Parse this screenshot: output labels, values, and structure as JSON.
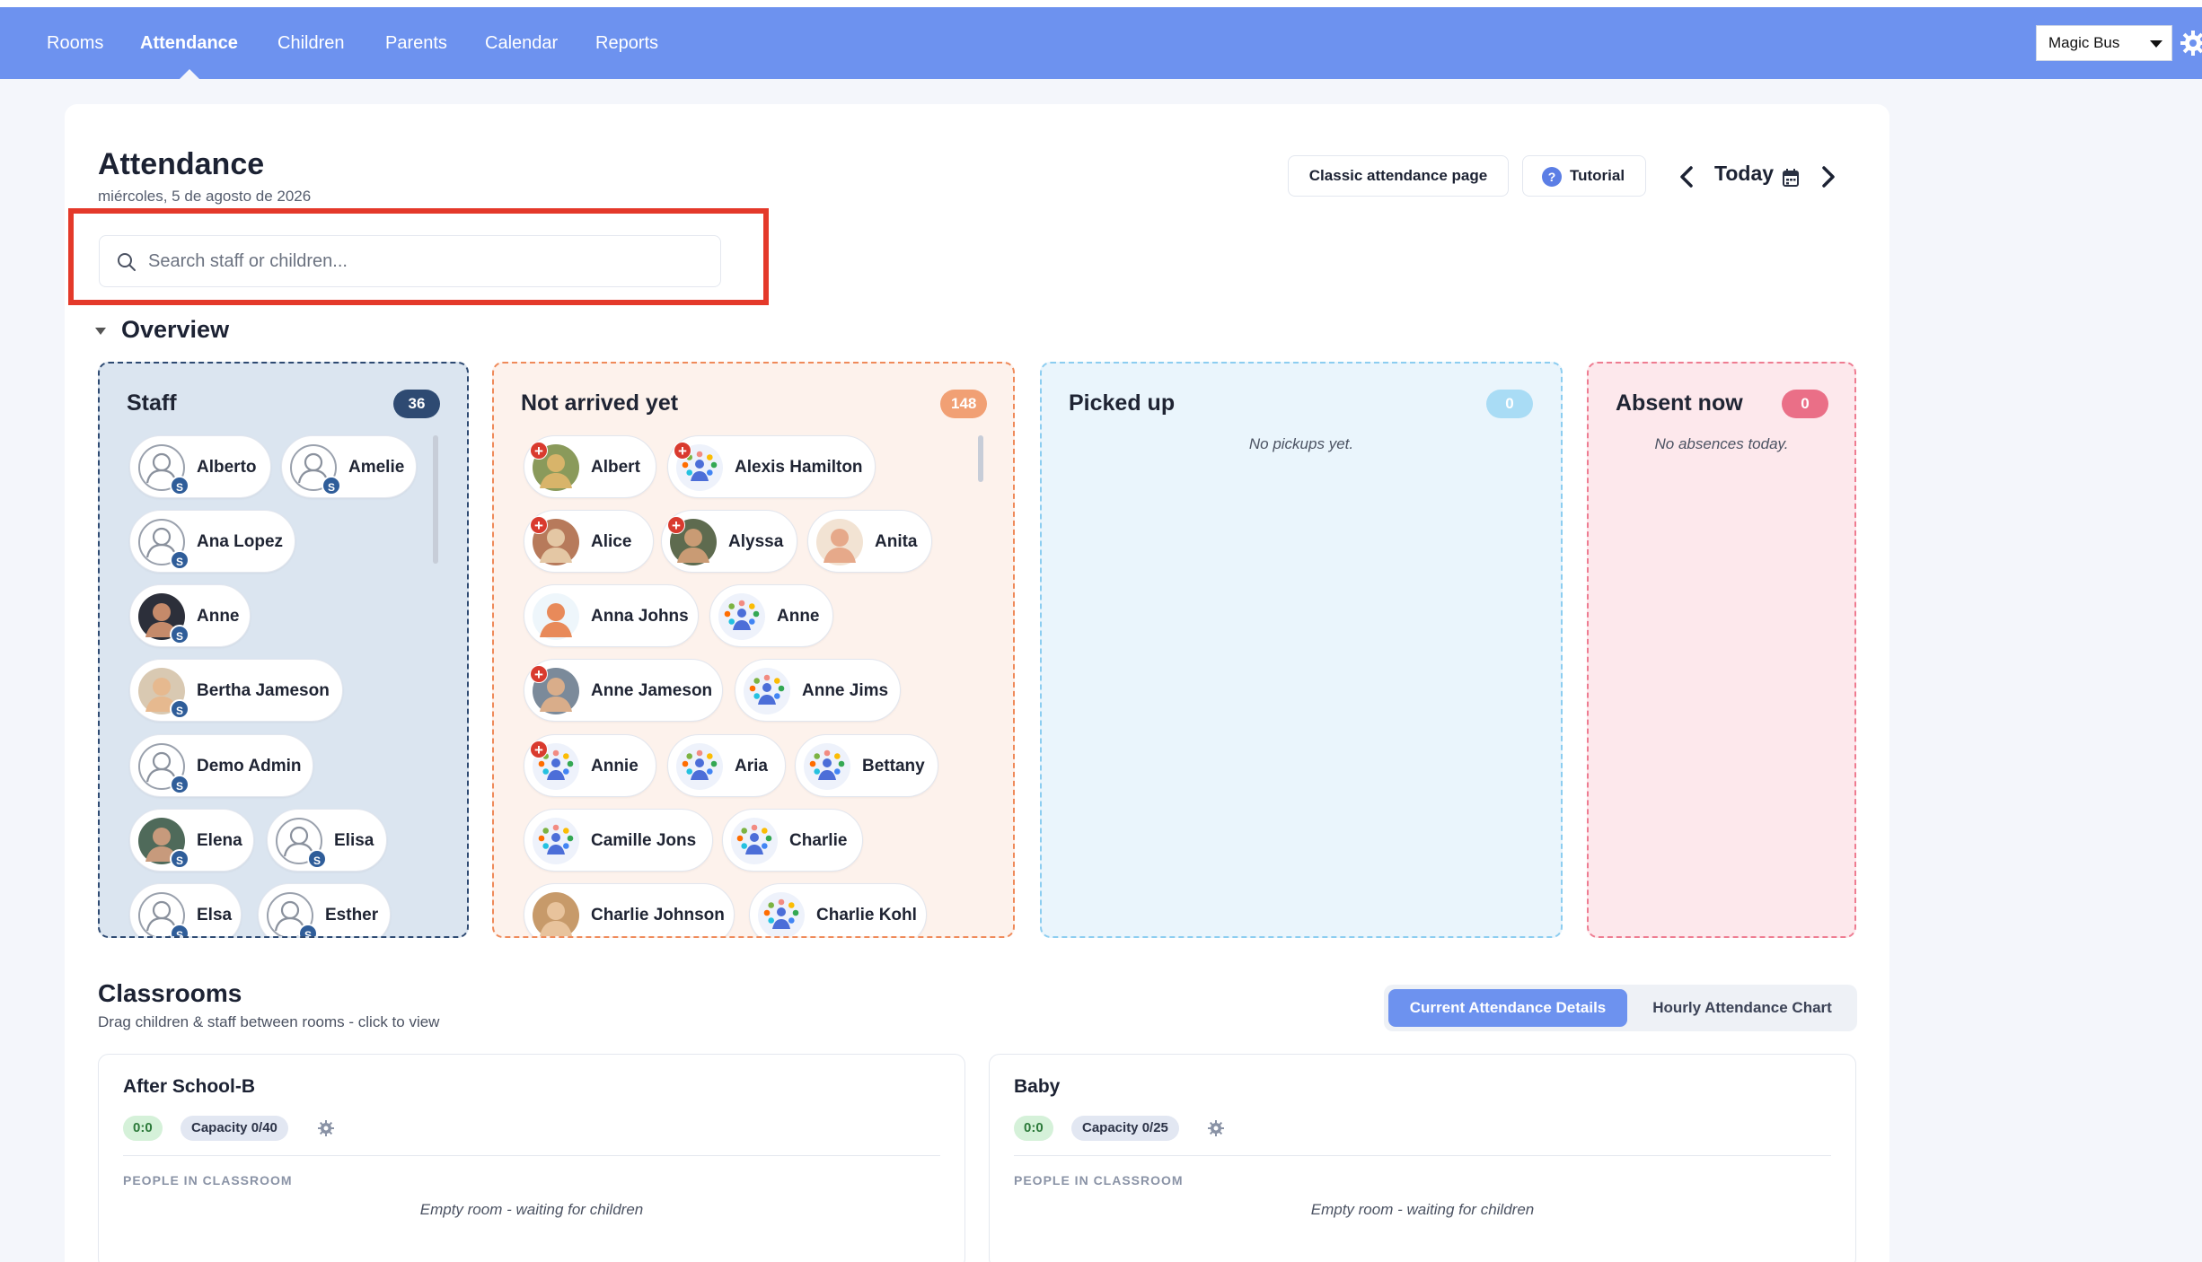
{
  "nav": {
    "items": [
      {
        "label": "Rooms",
        "active": false
      },
      {
        "label": "Attendance",
        "active": true
      },
      {
        "label": "Children",
        "active": false
      },
      {
        "label": "Parents",
        "active": false
      },
      {
        "label": "Calendar",
        "active": false
      },
      {
        "label": "Reports",
        "active": false
      }
    ],
    "organization": "Magic Bus",
    "settings_icon": "gear-icon"
  },
  "header": {
    "title": "Attendance",
    "date": "miércoles, 5 de agosto de 2026",
    "classic_button": "Classic attendance page",
    "tutorial_button": "Tutorial",
    "tutorial_icon": "?",
    "today_label": "Today"
  },
  "search": {
    "placeholder": "Search staff or children..."
  },
  "overview": {
    "heading": "Overview",
    "staff": {
      "title": "Staff",
      "count": "36",
      "badge_letter": "S",
      "people": [
        "Alberto",
        "Amelie",
        "Ana Lopez",
        "Anne",
        "Bertha Jameson",
        "Demo Admin",
        "Elena",
        "Elisa",
        "Elsa",
        "Esther"
      ]
    },
    "not_arrived": {
      "title": "Not arrived yet",
      "count": "148",
      "plus_symbol": "+",
      "people": [
        "Albert",
        "Alexis Hamilton",
        "Alice",
        "Alyssa",
        "Anita",
        "Anna Johns",
        "Anne",
        "Anne Jameson",
        "Anne Jims",
        "Annie",
        "Aria",
        "Bettany",
        "Camille Jons",
        "Charlie",
        "Charlie Johnson",
        "Charlie Kohl"
      ]
    },
    "picked_up": {
      "title": "Picked up",
      "count": "0",
      "empty": "No pickups yet."
    },
    "absent": {
      "title": "Absent now",
      "count": "0",
      "empty": "No absences today."
    }
  },
  "classrooms": {
    "title": "Classrooms",
    "subtitle": "Drag children & staff between rooms - click to view",
    "tabs": [
      "Current Attendance Details",
      "Hourly Attendance Chart"
    ],
    "active_tab": 0,
    "section_label": "PEOPLE IN CLASSROOM",
    "empty_label": "Empty room - waiting for children",
    "rooms": [
      {
        "name": "After School-B",
        "ratio": "0:0",
        "capacity": "Capacity 0/40"
      },
      {
        "name": "Baby",
        "ratio": "0:0",
        "capacity": "Capacity 0/25"
      }
    ]
  },
  "colors": {
    "nav_bg": "#6d92ef",
    "accent": "#5b7ee5",
    "staff_panel_bg": "#dbe5f0",
    "staff_border": "#2e4a72",
    "not_arrived_bg": "#fdf2ec",
    "not_arrived_border": "#ef8a5a",
    "picked_up_bg": "#eaf5fc",
    "picked_up_border": "#8ccdf0",
    "absent_bg": "#fde8ec",
    "absent_border": "#ee7c91",
    "highlight": "#e4392a"
  }
}
